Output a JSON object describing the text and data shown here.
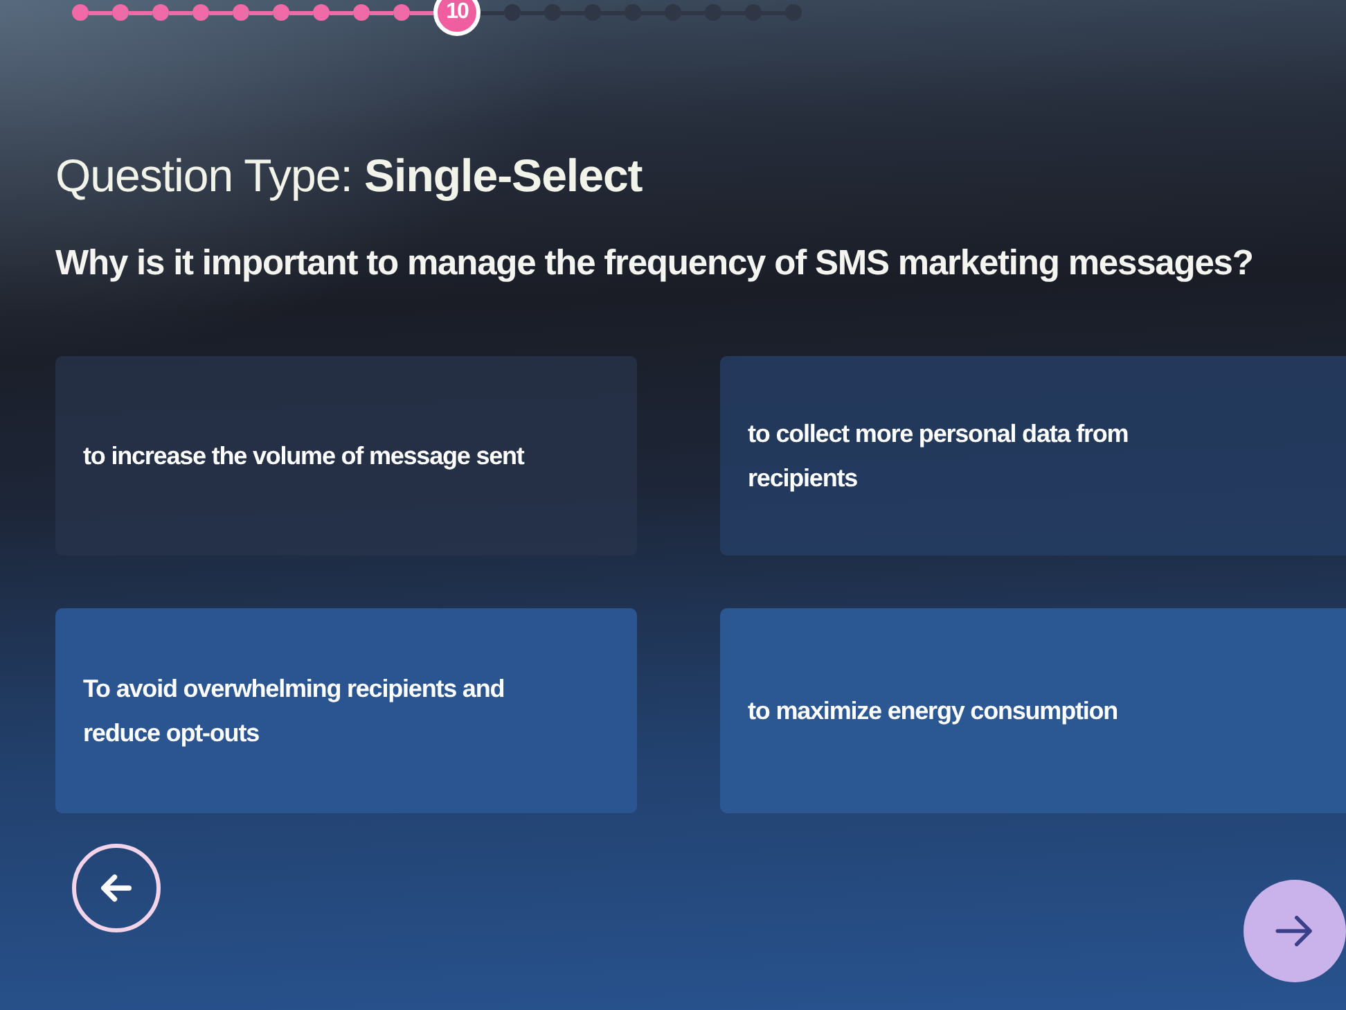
{
  "progress": {
    "steps": [
      {
        "completed": true,
        "selected": false
      },
      {
        "completed": true,
        "selected": false
      },
      {
        "completed": true,
        "selected": false
      },
      {
        "completed": true,
        "selected": false
      },
      {
        "completed": true,
        "selected": false
      },
      {
        "completed": true,
        "selected": false
      },
      {
        "completed": true,
        "selected": false
      },
      {
        "completed": true,
        "selected": false
      },
      {
        "completed": true,
        "selected": false
      },
      {
        "completed": false,
        "selected": true,
        "label": "10"
      },
      {
        "completed": false,
        "selected": false
      },
      {
        "completed": false,
        "selected": false
      },
      {
        "completed": false,
        "selected": false
      },
      {
        "completed": false,
        "selected": false
      },
      {
        "completed": false,
        "selected": false
      },
      {
        "completed": false,
        "selected": false
      },
      {
        "completed": false,
        "selected": false
      },
      {
        "completed": false,
        "selected": false
      }
    ]
  },
  "question_type": "Question Type: **Single-Select**",
  "question": "Why is it important to manage the frequency of SMS marketing messages?",
  "options": [
    {
      "text": "to increase the volume of message sent",
      "selected": false
    },
    {
      "text": "to collect more personal data from recipients",
      "selected": false
    },
    {
      "text": "To avoid overwhelming recipients and reduce opt-outs",
      "selected": false
    },
    {
      "text": "to maximize energy consumption",
      "selected": false
    }
  ],
  "navigation": {
    "back": {
      "disabled": false
    },
    "next": {
      "disabled": true
    }
  }
}
